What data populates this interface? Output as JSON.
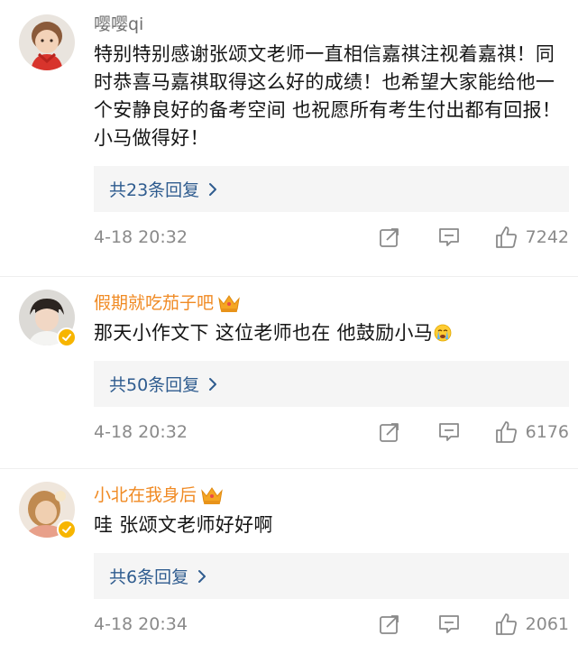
{
  "comments": [
    {
      "username": "嘤嘤qi",
      "text": "特别特别感谢张颂文老师一直相信嘉祺注视着嘉祺！同时恭喜马嘉祺取得这么好的成绩！也希望大家能给他一个安静良好的备考空间 也祝愿所有考生付出都有回报！小马做得好！",
      "replies_label": "共23条回复",
      "time": "4-18 20:32",
      "likes": "7242"
    },
    {
      "username": "假期就吃茄子吧",
      "text": "那天小作文下 这位老师也在 他鼓励小马",
      "text_emoji": "crying-emoji",
      "replies_label": "共50条回复",
      "time": "4-18 20:32",
      "likes": "6176"
    },
    {
      "username": "小北在我身后",
      "text": "哇 张颂文老师好好啊",
      "replies_label": "共6条回复",
      "time": "4-18 20:34",
      "likes": "2061"
    }
  ],
  "colors": {
    "link": "#2f5c8f",
    "vip_name": "#f08a23",
    "meta": "#8a8a8a",
    "reply_bg": "#f5f5f5"
  },
  "icons": [
    "share-icon",
    "comment-icon",
    "like-icon",
    "crown-icon",
    "verified-icon",
    "chevron-right-icon"
  ]
}
